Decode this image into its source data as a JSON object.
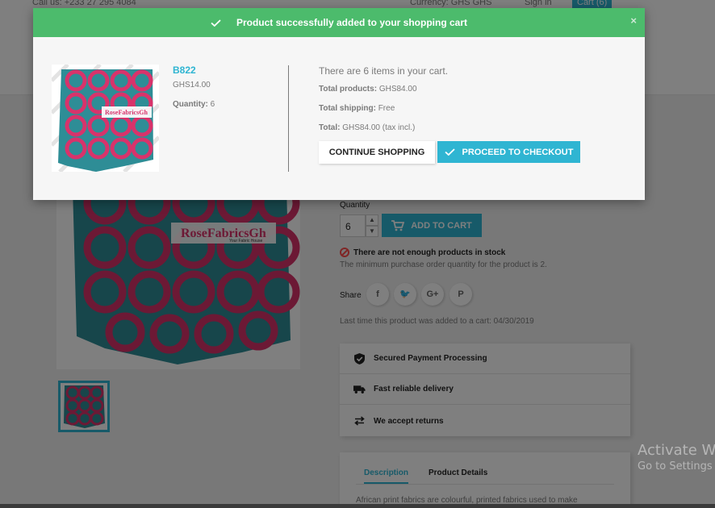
{
  "header": {
    "phone": "Call us: +233 27 295 4084",
    "currency": "Currency: GHS GHS",
    "sign_in": "Sign in",
    "cart": "Cart (6)"
  },
  "product_page": {
    "quantity_label": "Quantity",
    "quantity_value": "6",
    "add_to_cart": "ADD TO CART",
    "stock_warning": "There are not enough products in stock",
    "min_quantity_note": "The minimum purchase order quantity for the product is 2.",
    "share_label": "Share",
    "social_icons": [
      "facebook-icon",
      "twitter-icon",
      "google-plus-icon",
      "pinterest-icon"
    ],
    "social_glyphs": [
      "f",
      "🐦",
      "G+",
      "P"
    ],
    "last_added": "Last time this product was added to a cart: 04/30/2019",
    "reassurance": [
      {
        "icon": "shield-check-icon",
        "label": "Secured Payment Processing"
      },
      {
        "icon": "truck-icon",
        "label": "Fast reliable delivery"
      },
      {
        "icon": "exchange-arrows-icon",
        "label": "We accept returns"
      }
    ],
    "tabs": [
      {
        "label": "Description",
        "active": true
      },
      {
        "label": "Product Details",
        "active": false
      }
    ],
    "description_snippet": "African print fabrics are colourful, printed fabrics used to make",
    "image_brand": "RoseFabricsGh",
    "image_tagline": "Your Fabric House"
  },
  "modal": {
    "title": "Product successfully added to your shopping cart",
    "close": "×",
    "product_name": "B822",
    "product_price": "GHS14.00",
    "quantity_label": "Quantity:",
    "quantity_value": "6",
    "cart_count_text": "There are 6 items in your cart.",
    "total_products_label": "Total products:",
    "total_products_value": "GHS84.00",
    "total_shipping_label": "Total shipping:",
    "total_shipping_value": "Free",
    "total_label": "Total:",
    "total_value": "GHS84.00 (tax incl.)",
    "continue_button": "Continue shopping",
    "checkout_button": "Proceed to checkout"
  },
  "os_overlay": {
    "line1": "Activate W",
    "line2": "Go to Settings"
  },
  "colors": {
    "accent": "#2fb5d2",
    "success": "#4cbb6c",
    "fabric_pink": "#d8336b",
    "fabric_teal": "#2e8d96"
  }
}
